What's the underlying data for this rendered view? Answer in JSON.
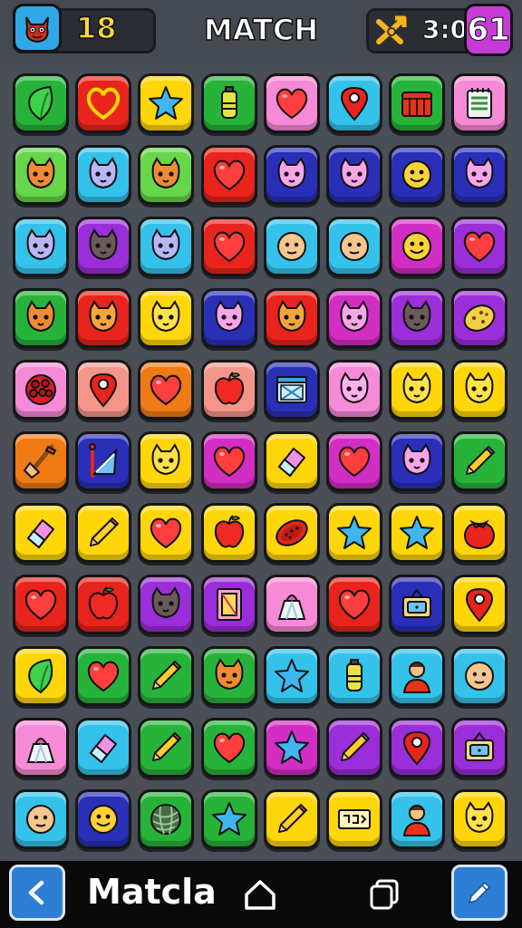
{
  "header": {
    "score": "18",
    "title": "MATCH",
    "moves": "3:0",
    "level": "61"
  },
  "footer": {
    "label": "Matcla"
  },
  "colors": {
    "red": "#e8241c",
    "green": "#27b33a",
    "yellow": "#ffd60a",
    "blue": "#2a2fb8",
    "cyan": "#35c2ea",
    "pink": "#f78ad6",
    "purple": "#9a2ed8",
    "orange": "#f07a14",
    "magenta": "#d22ec4",
    "salmon": "#f4958a",
    "lime": "#66d64a"
  },
  "board": [
    [
      {
        "color": "green",
        "icon": "leaf"
      },
      {
        "color": "red",
        "icon": "heart-outline"
      },
      {
        "color": "yellow",
        "icon": "star"
      },
      {
        "color": "green",
        "icon": "battery"
      },
      {
        "color": "pink",
        "icon": "heart"
      },
      {
        "color": "cyan",
        "icon": "map-pin"
      },
      {
        "color": "green",
        "icon": "box"
      },
      {
        "color": "pink",
        "icon": "notepad"
      }
    ],
    [
      {
        "color": "lime",
        "icon": "cat"
      },
      {
        "color": "cyan",
        "icon": "cat"
      },
      {
        "color": "lime",
        "icon": "cat"
      },
      {
        "color": "red",
        "icon": "heart"
      },
      {
        "color": "blue",
        "icon": "cat"
      },
      {
        "color": "blue",
        "icon": "cat"
      },
      {
        "color": "blue",
        "icon": "smiley"
      },
      {
        "color": "blue",
        "icon": "cat"
      }
    ],
    [
      {
        "color": "cyan",
        "icon": "cat"
      },
      {
        "color": "purple",
        "icon": "cat"
      },
      {
        "color": "cyan",
        "icon": "cat"
      },
      {
        "color": "red",
        "icon": "heart"
      },
      {
        "color": "cyan",
        "icon": "face"
      },
      {
        "color": "cyan",
        "icon": "face"
      },
      {
        "color": "magenta",
        "icon": "smiley"
      },
      {
        "color": "purple",
        "icon": "heart"
      }
    ],
    [
      {
        "color": "green",
        "icon": "cat"
      },
      {
        "color": "red",
        "icon": "cat"
      },
      {
        "color": "yellow",
        "icon": "cat"
      },
      {
        "color": "blue",
        "icon": "cat"
      },
      {
        "color": "red",
        "icon": "cat"
      },
      {
        "color": "magenta",
        "icon": "cat"
      },
      {
        "color": "purple",
        "icon": "cat"
      },
      {
        "color": "purple",
        "icon": "cookie"
      }
    ],
    [
      {
        "color": "pink",
        "icon": "berry"
      },
      {
        "color": "salmon",
        "icon": "map-pin"
      },
      {
        "color": "orange",
        "icon": "heart"
      },
      {
        "color": "salmon",
        "icon": "apple"
      },
      {
        "color": "blue",
        "icon": "window"
      },
      {
        "color": "pink",
        "icon": "cat"
      },
      {
        "color": "yellow",
        "icon": "cat"
      },
      {
        "color": "yellow",
        "icon": "cat"
      }
    ],
    [
      {
        "color": "orange",
        "icon": "broom"
      },
      {
        "color": "blue",
        "icon": "flag"
      },
      {
        "color": "yellow",
        "icon": "cat"
      },
      {
        "color": "magenta",
        "icon": "heart"
      },
      {
        "color": "yellow",
        "icon": "eraser"
      },
      {
        "color": "magenta",
        "icon": "heart"
      },
      {
        "color": "blue",
        "icon": "cat"
      },
      {
        "color": "green",
        "icon": "pencil"
      }
    ],
    [
      {
        "color": "yellow",
        "icon": "eraser"
      },
      {
        "color": "yellow",
        "icon": "pencil"
      },
      {
        "color": "yellow",
        "icon": "heart"
      },
      {
        "color": "yellow",
        "icon": "apple"
      },
      {
        "color": "yellow",
        "icon": "melon"
      },
      {
        "color": "yellow",
        "icon": "star"
      },
      {
        "color": "yellow",
        "icon": "star"
      },
      {
        "color": "yellow",
        "icon": "tomato"
      }
    ],
    [
      {
        "color": "red",
        "icon": "heart"
      },
      {
        "color": "red",
        "icon": "apple"
      },
      {
        "color": "purple",
        "icon": "cat"
      },
      {
        "color": "purple",
        "icon": "frame"
      },
      {
        "color": "pink",
        "icon": "shaker"
      },
      {
        "color": "red",
        "icon": "heart"
      },
      {
        "color": "blue",
        "icon": "radio"
      },
      {
        "color": "yellow",
        "icon": "map-pin"
      }
    ],
    [
      {
        "color": "yellow",
        "icon": "leaf"
      },
      {
        "color": "green",
        "icon": "heart"
      },
      {
        "color": "green",
        "icon": "pencil"
      },
      {
        "color": "green",
        "icon": "cat"
      },
      {
        "color": "cyan",
        "icon": "star"
      },
      {
        "color": "cyan",
        "icon": "battery"
      },
      {
        "color": "cyan",
        "icon": "person"
      },
      {
        "color": "cyan",
        "icon": "face"
      }
    ],
    [
      {
        "color": "pink",
        "icon": "shaker"
      },
      {
        "color": "cyan",
        "icon": "eraser"
      },
      {
        "color": "green",
        "icon": "pencil"
      },
      {
        "color": "green",
        "icon": "heart"
      },
      {
        "color": "magenta",
        "icon": "star"
      },
      {
        "color": "purple",
        "icon": "pencil"
      },
      {
        "color": "purple",
        "icon": "map-pin"
      },
      {
        "color": "purple",
        "icon": "radio"
      }
    ],
    [
      {
        "color": "cyan",
        "icon": "face"
      },
      {
        "color": "blue",
        "icon": "smiley"
      },
      {
        "color": "green",
        "icon": "yarn"
      },
      {
        "color": "green",
        "icon": "star"
      },
      {
        "color": "yellow",
        "icon": "pencil"
      },
      {
        "color": "yellow",
        "icon": "ticket"
      },
      {
        "color": "cyan",
        "icon": "person"
      },
      {
        "color": "yellow",
        "icon": "cat"
      }
    ]
  ]
}
